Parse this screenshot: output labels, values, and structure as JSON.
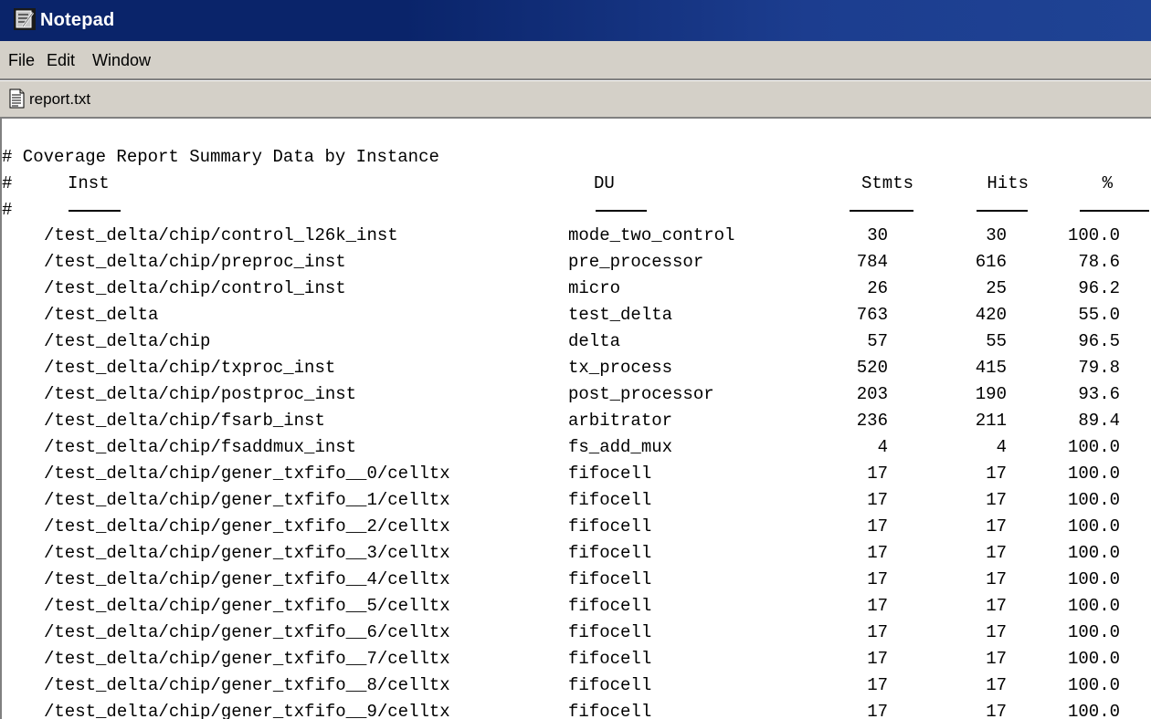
{
  "window": {
    "title": "Notepad"
  },
  "menu": {
    "items": [
      "File",
      "Edit",
      "Window"
    ]
  },
  "document": {
    "name": "report.txt"
  },
  "report": {
    "heading": "# Coverage Report Summary Data by Instance",
    "hash": "#",
    "columns": {
      "inst": "Inst",
      "du": "DU",
      "stmts": "Stmts",
      "hits": "Hits",
      "pct": "%"
    },
    "rows": [
      {
        "inst": "/test_delta/chip/control_l26k_inst",
        "du": "mode_two_control",
        "stmts": "30",
        "hits": "30",
        "pct": "100.0"
      },
      {
        "inst": "/test_delta/chip/preproc_inst",
        "du": "pre_processor",
        "stmts": "784",
        "hits": "616",
        "pct": "78.6"
      },
      {
        "inst": "/test_delta/chip/control_inst",
        "du": "micro",
        "stmts": "26",
        "hits": "25",
        "pct": "96.2"
      },
      {
        "inst": "/test_delta",
        "du": "test_delta",
        "stmts": "763",
        "hits": "420",
        "pct": "55.0"
      },
      {
        "inst": "/test_delta/chip",
        "du": "delta",
        "stmts": "57",
        "hits": "55",
        "pct": "96.5"
      },
      {
        "inst": "/test_delta/chip/txproc_inst",
        "du": "tx_process",
        "stmts": "520",
        "hits": "415",
        "pct": "79.8"
      },
      {
        "inst": "/test_delta/chip/postproc_inst",
        "du": "post_processor",
        "stmts": "203",
        "hits": "190",
        "pct": "93.6"
      },
      {
        "inst": "/test_delta/chip/fsarb_inst",
        "du": "arbitrator",
        "stmts": "236",
        "hits": "211",
        "pct": "89.4"
      },
      {
        "inst": "/test_delta/chip/fsaddmux_inst",
        "du": "fs_add_mux",
        "stmts": "4",
        "hits": "4",
        "pct": "100.0"
      },
      {
        "inst": "/test_delta/chip/gener_txfifo__0/celltx",
        "du": "fifocell",
        "stmts": "17",
        "hits": "17",
        "pct": "100.0"
      },
      {
        "inst": "/test_delta/chip/gener_txfifo__1/celltx",
        "du": "fifocell",
        "stmts": "17",
        "hits": "17",
        "pct": "100.0"
      },
      {
        "inst": "/test_delta/chip/gener_txfifo__2/celltx",
        "du": "fifocell",
        "stmts": "17",
        "hits": "17",
        "pct": "100.0"
      },
      {
        "inst": "/test_delta/chip/gener_txfifo__3/celltx",
        "du": "fifocell",
        "stmts": "17",
        "hits": "17",
        "pct": "100.0"
      },
      {
        "inst": "/test_delta/chip/gener_txfifo__4/celltx",
        "du": "fifocell",
        "stmts": "17",
        "hits": "17",
        "pct": "100.0"
      },
      {
        "inst": "/test_delta/chip/gener_txfifo__5/celltx",
        "du": "fifocell",
        "stmts": "17",
        "hits": "17",
        "pct": "100.0"
      },
      {
        "inst": "/test_delta/chip/gener_txfifo__6/celltx",
        "du": "fifocell",
        "stmts": "17",
        "hits": "17",
        "pct": "100.0"
      },
      {
        "inst": "/test_delta/chip/gener_txfifo__7/celltx",
        "du": "fifocell",
        "stmts": "17",
        "hits": "17",
        "pct": "100.0"
      },
      {
        "inst": "/test_delta/chip/gener_txfifo__8/celltx",
        "du": "fifocell",
        "stmts": "17",
        "hits": "17",
        "pct": "100.0"
      },
      {
        "inst": "/test_delta/chip/gener_txfifo__9/celltx",
        "du": "fifocell",
        "stmts": "17",
        "hits": "17",
        "pct": "100.0"
      }
    ]
  },
  "icons": {
    "app": "notepad-app-icon",
    "document": "text-document-icon"
  },
  "colors": {
    "titlebar": "#0a246a",
    "chrome": "#d4d0c8",
    "editor_bg": "#ffffff"
  }
}
